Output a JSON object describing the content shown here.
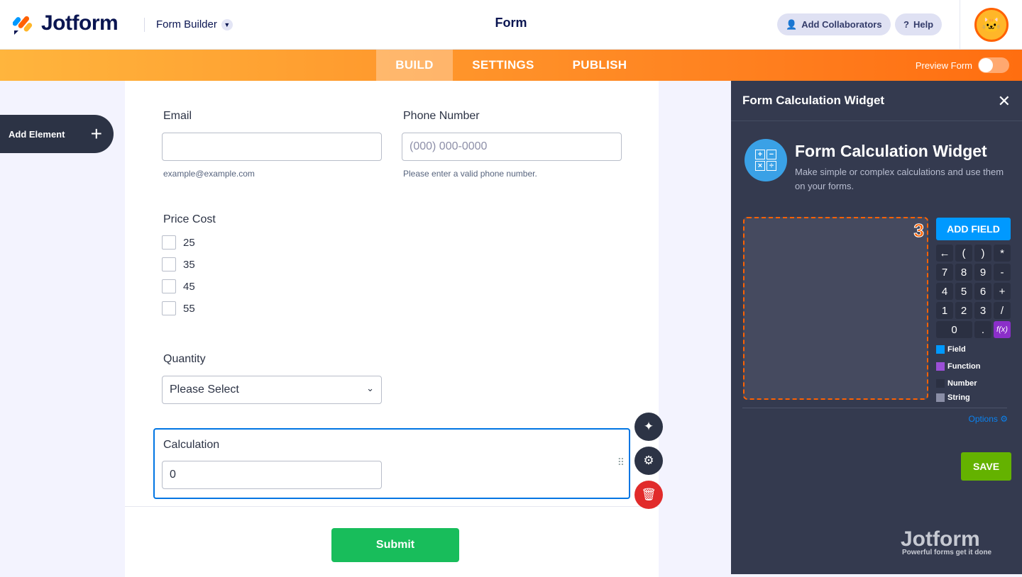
{
  "header": {
    "brand": "Jotform",
    "product": "Form Builder",
    "title": "Form",
    "add_collaborators": "Add Collaborators",
    "help": "Help"
  },
  "tabs": [
    {
      "label": "BUILD"
    },
    {
      "label": "SETTINGS"
    },
    {
      "label": "PUBLISH"
    }
  ],
  "preview_label": "Preview Form",
  "add_element": "Add Element",
  "form": {
    "email": {
      "label": "Email",
      "value": "",
      "sublabel": "example@example.com"
    },
    "phone": {
      "label": "Phone Number",
      "placeholder": "(000) 000-0000",
      "sublabel": "Please enter a valid phone number."
    },
    "price": {
      "label": "Price Cost",
      "options": [
        "25",
        "35",
        "45",
        "55"
      ]
    },
    "quantity": {
      "label": "Quantity",
      "value": "Please Select"
    },
    "calculation": {
      "label": "Calculation",
      "value": "0"
    },
    "submit": "Submit"
  },
  "panel": {
    "header": "Form Calculation Widget",
    "title": "Form Calculation Widget",
    "description": "Make simple or complex calculations and use them on your forms.",
    "editor_badge": "3",
    "add_field": "ADD FIELD",
    "keys": [
      "←",
      "(",
      ")",
      "*",
      "7",
      "8",
      "9",
      "-",
      "4",
      "5",
      "6",
      "+",
      "1",
      "2",
      "3",
      "/",
      "0",
      ".",
      "f(x)"
    ],
    "legend": [
      {
        "label": "Field",
        "color": "#0099ff"
      },
      {
        "label": "Function",
        "color": "#9b4fd6"
      },
      {
        "label": "Number",
        "color": "#2b3042"
      },
      {
        "label": "String",
        "color": "#8a8ea6"
      }
    ],
    "options": "Options",
    "save": "SAVE",
    "brand": "Jotform",
    "tagline": "Powerful forms get it done"
  }
}
